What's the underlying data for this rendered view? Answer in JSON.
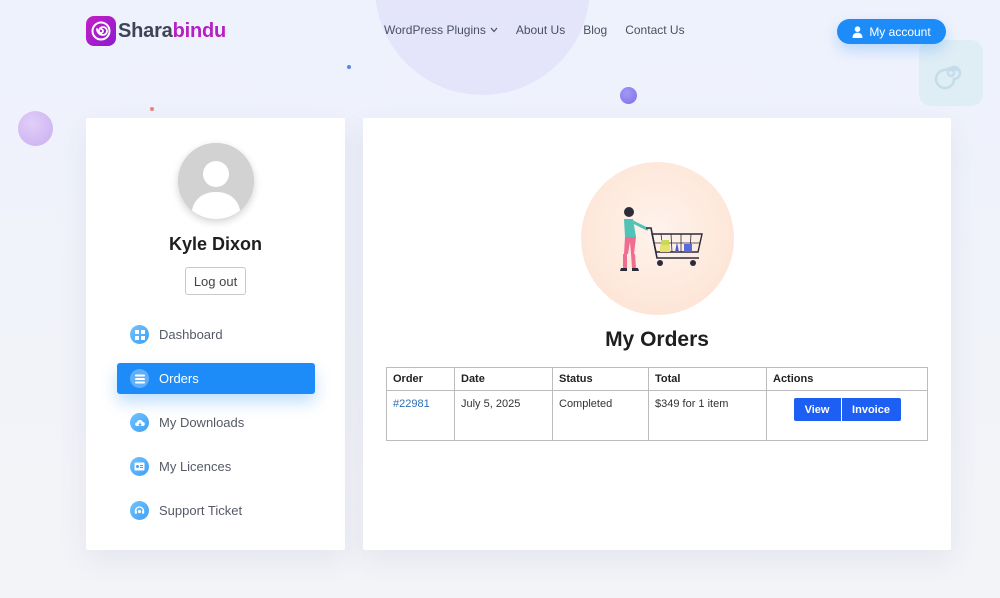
{
  "brand": {
    "name_part1": "Shara",
    "name_part2": "bindu",
    "accent_color": "#b61fc5",
    "primary_color": "#1d8cf8"
  },
  "nav": {
    "items": [
      {
        "label": "WordPress Plugins",
        "has_dropdown": true
      },
      {
        "label": "About Us"
      },
      {
        "label": "Blog"
      },
      {
        "label": "Contact Us"
      }
    ],
    "account_label": "My account"
  },
  "sidebar": {
    "user_name": "Kyle Dixon",
    "logout_label": "Log out",
    "items": [
      {
        "label": "Dashboard",
        "icon": "dashboard-icon",
        "active": false
      },
      {
        "label": "Orders",
        "icon": "orders-icon",
        "active": true
      },
      {
        "label": "My Downloads",
        "icon": "cloud-download-icon",
        "active": false
      },
      {
        "label": "My Licences",
        "icon": "licence-card-icon",
        "active": false
      },
      {
        "label": "Support Ticket",
        "icon": "support-headset-icon",
        "active": false
      }
    ]
  },
  "main": {
    "title": "My Orders",
    "illustration": "shopping-cart-illustration",
    "table": {
      "headers": [
        "Order",
        "Date",
        "Status",
        "Total",
        "Actions"
      ],
      "rows": [
        {
          "order": "#22981",
          "date": "July 5, 2025",
          "status": "Completed",
          "total": "$349 for 1 item",
          "actions": [
            "View",
            "Invoice"
          ]
        }
      ]
    }
  }
}
